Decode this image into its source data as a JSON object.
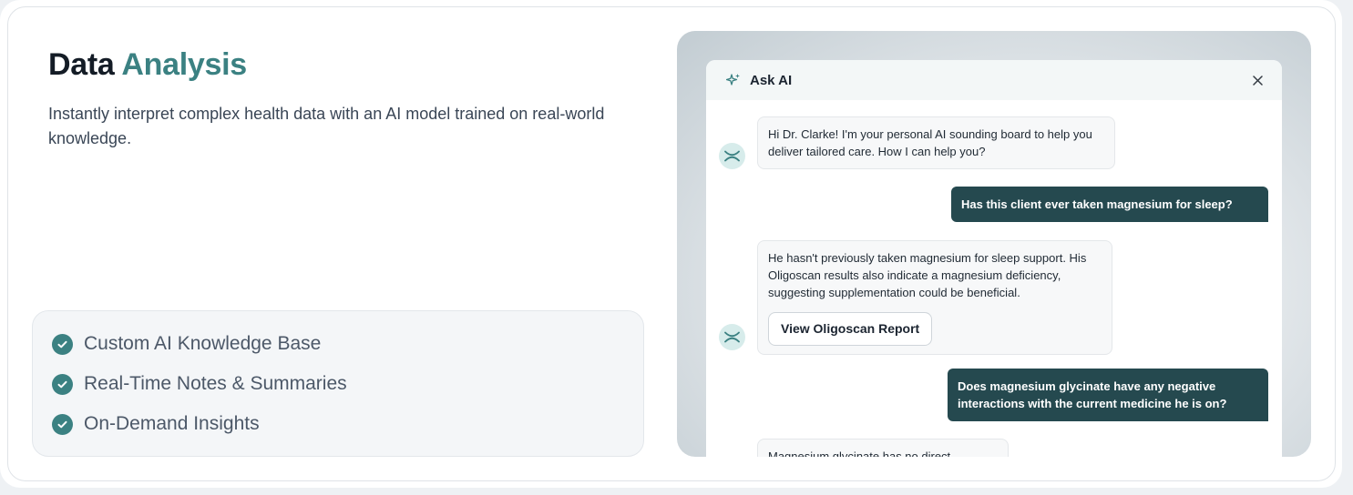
{
  "section": {
    "title_main": "Data",
    "title_accent": "Analysis",
    "subtitle": "Instantly interpret complex health data with an AI model trained on real-world knowledge.",
    "accent_color": "#3b8182"
  },
  "features": [
    {
      "label": "Custom AI Knowledge Base",
      "icon": "check-circle-icon"
    },
    {
      "label": "Real-Time Notes & Summaries",
      "icon": "check-circle-icon"
    },
    {
      "label": "On-Demand Insights",
      "icon": "check-circle-icon"
    }
  ],
  "chat": {
    "title": "Ask AI",
    "header_icon": "sparkle-icon",
    "close_icon": "close-icon",
    "messages": [
      {
        "role": "ai",
        "text": "Hi Dr. Clarke! I'm your personal AI sounding board to help you deliver tailored care. How I can help you?"
      },
      {
        "role": "user",
        "text": "Has this client ever taken magnesium for sleep?"
      },
      {
        "role": "ai",
        "text": "He hasn't previously taken magnesium for sleep support. His Oligoscan results also indicate a magnesium deficiency, suggesting supplementation could be beneficial.",
        "button": "View Oligoscan Report"
      },
      {
        "role": "user",
        "text": "Does magnesium glycinate have any negative interactions with the current medicine he is on?"
      },
      {
        "role": "ai",
        "text": "Magnesium glycinate has no direct"
      }
    ],
    "user_bubble_color": "#25494f"
  }
}
